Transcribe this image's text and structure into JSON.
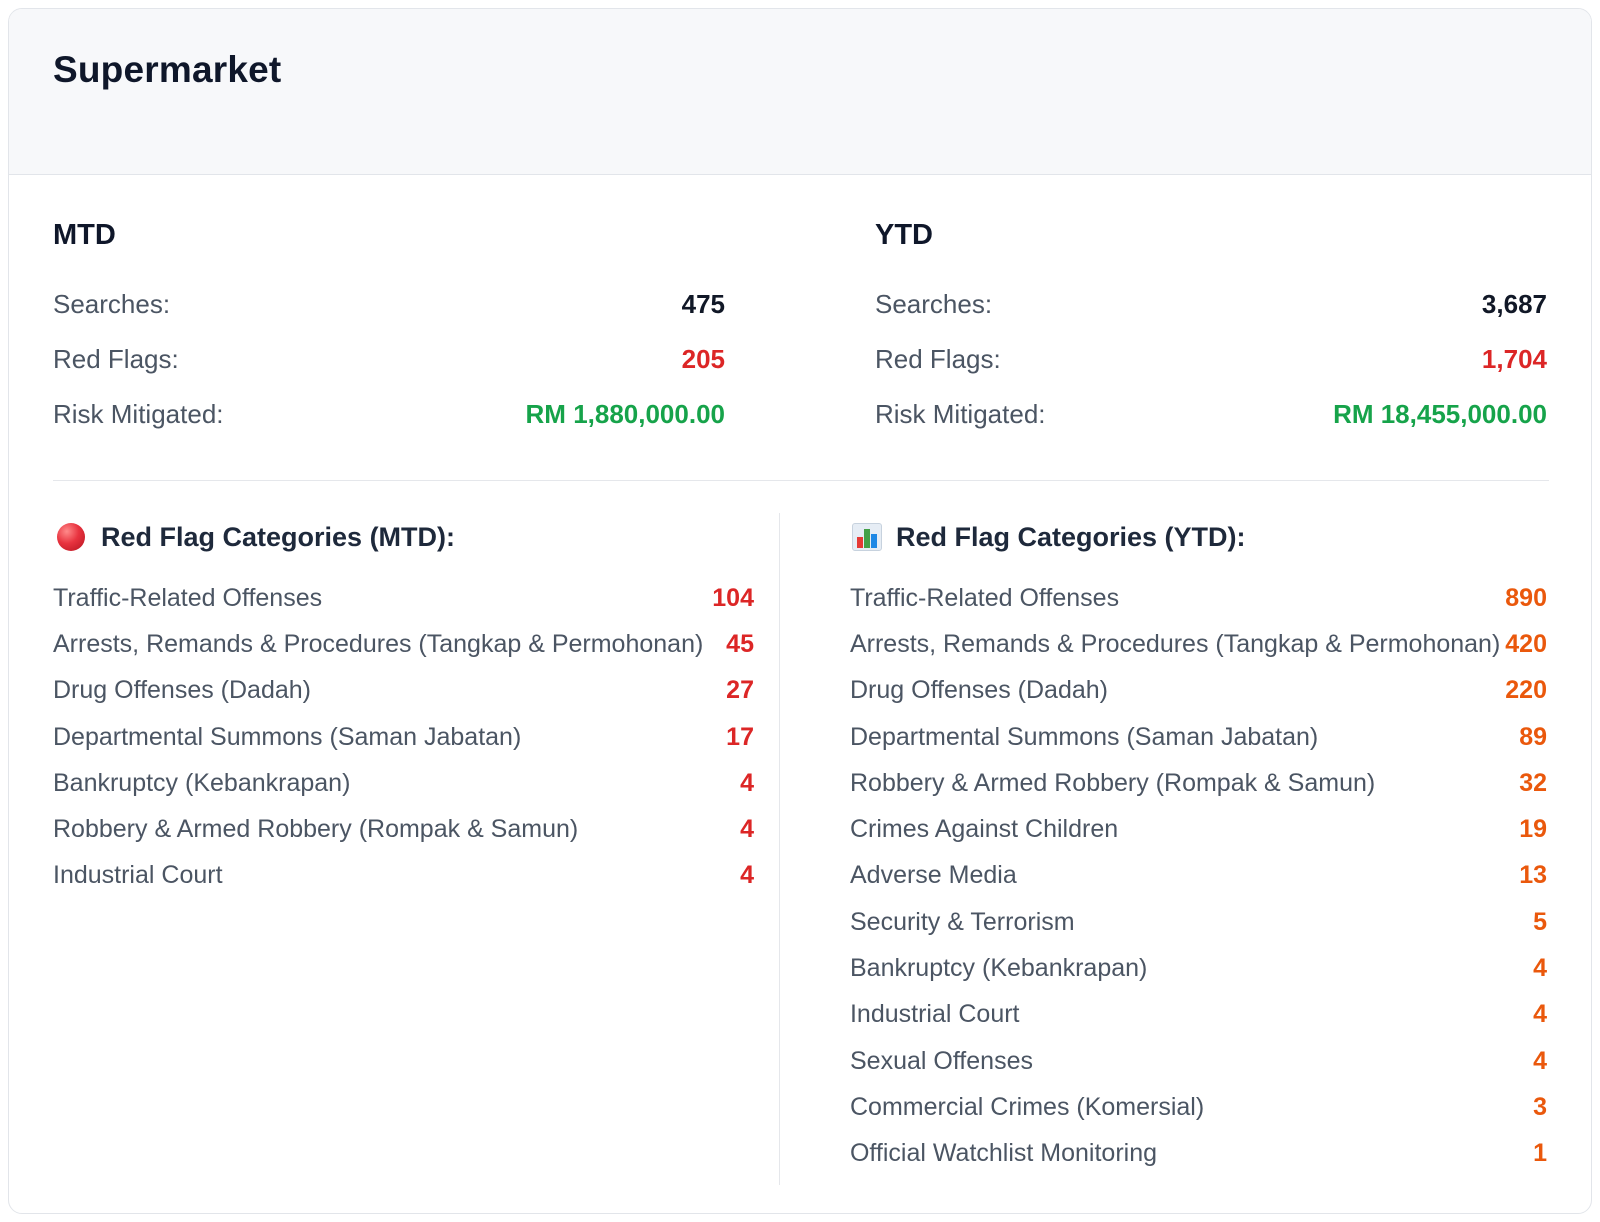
{
  "card": {
    "title": "Supermarket"
  },
  "mtd": {
    "heading": "MTD",
    "searches_label": "Searches:",
    "searches_value": "475",
    "red_flags_label": "Red Flags:",
    "red_flags_value": "205",
    "risk_label": "Risk Mitigated:",
    "risk_value": "RM 1,880,000.00"
  },
  "ytd": {
    "heading": "YTD",
    "searches_label": "Searches:",
    "searches_value": "3,687",
    "red_flags_label": "Red Flags:",
    "red_flags_value": "1,704",
    "risk_label": "Risk Mitigated:",
    "risk_value": "RM 18,455,000.00"
  },
  "categories_mtd": {
    "icon": "red-circle-icon",
    "heading": "Red Flag Categories (MTD):",
    "items": [
      {
        "label": "Traffic-Related Offenses",
        "value": "104"
      },
      {
        "label": "Arrests, Remands & Procedures (Tangkap & Permohonan)",
        "value": "45"
      },
      {
        "label": "Drug Offenses (Dadah)",
        "value": "27"
      },
      {
        "label": "Departmental Summons (Saman Jabatan)",
        "value": "17"
      },
      {
        "label": "Bankruptcy (Kebankrapan)",
        "value": "4"
      },
      {
        "label": "Robbery & Armed Robbery (Rompak & Samun)",
        "value": "4"
      },
      {
        "label": "Industrial Court",
        "value": "4"
      }
    ]
  },
  "categories_ytd": {
    "icon": "bar-chart-icon",
    "heading": "Red Flag Categories (YTD):",
    "items": [
      {
        "label": "Traffic-Related Offenses",
        "value": "890"
      },
      {
        "label": "Arrests, Remands & Procedures (Tangkap & Permohonan)",
        "value": "420"
      },
      {
        "label": "Drug Offenses (Dadah)",
        "value": "220"
      },
      {
        "label": "Departmental Summons (Saman Jabatan)",
        "value": "89"
      },
      {
        "label": "Robbery & Armed Robbery (Rompak & Samun)",
        "value": "32"
      },
      {
        "label": "Crimes Against Children",
        "value": "19"
      },
      {
        "label": "Adverse Media",
        "value": "13"
      },
      {
        "label": "Security & Terrorism",
        "value": "5"
      },
      {
        "label": "Bankruptcy (Kebankrapan)",
        "value": "4"
      },
      {
        "label": "Industrial Court",
        "value": "4"
      },
      {
        "label": "Sexual Offenses",
        "value": "4"
      },
      {
        "label": "Commercial Crimes (Komersial)",
        "value": "3"
      },
      {
        "label": "Official Watchlist Monitoring",
        "value": "1"
      }
    ]
  },
  "colors": {
    "dark_value": "#111827",
    "red_value": "#dc2626",
    "green_value": "#16a34a",
    "orange_value": "#ea580c"
  }
}
